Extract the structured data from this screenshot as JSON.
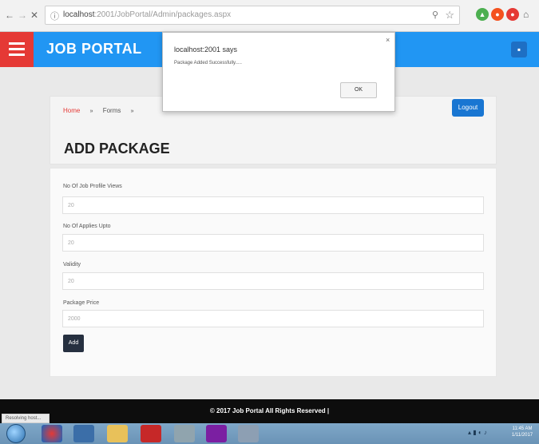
{
  "browser": {
    "back_icon": "back-arrow-icon",
    "forward_icon": "forward-arrow-icon",
    "stop_icon": "close-icon",
    "url_host": "localhost",
    "url_rest": ":2001/JobPortal/Admin/packages.aspx",
    "star_icon": "star-icon",
    "extension_colors": [
      "#4caf50",
      "#f4511e",
      "#e53935"
    ]
  },
  "header": {
    "title": "JOB PORTAL",
    "menu_icon": "hamburger-menu-icon",
    "accent": "#2196f3",
    "menu_bg": "#e53935"
  },
  "breadcrumb": {
    "home": "Home",
    "separator": "»",
    "second": "Forms",
    "third": "»"
  },
  "logout": "Logout",
  "page_title": "ADD PACKAGE",
  "form": {
    "fields": [
      {
        "label": "No Of Job Profile Views",
        "value": "20"
      },
      {
        "label": "No Of Applies Upto",
        "value": "20"
      },
      {
        "label": "Validity",
        "value": "20"
      },
      {
        "label": "Package Price",
        "value": "2000"
      }
    ],
    "submit_label": "Add"
  },
  "footer": {
    "text": "© 2017 Job Portal All Rights Reserved |"
  },
  "statusbar": {
    "text": "Resolving host..."
  },
  "taskbar": {
    "time": "11:45 AM",
    "date": "1/11/2017"
  },
  "dialog": {
    "title": "localhost:2001 says",
    "message": "Package Added Successfully.....",
    "ok_label": "OK",
    "close_label": "×"
  }
}
